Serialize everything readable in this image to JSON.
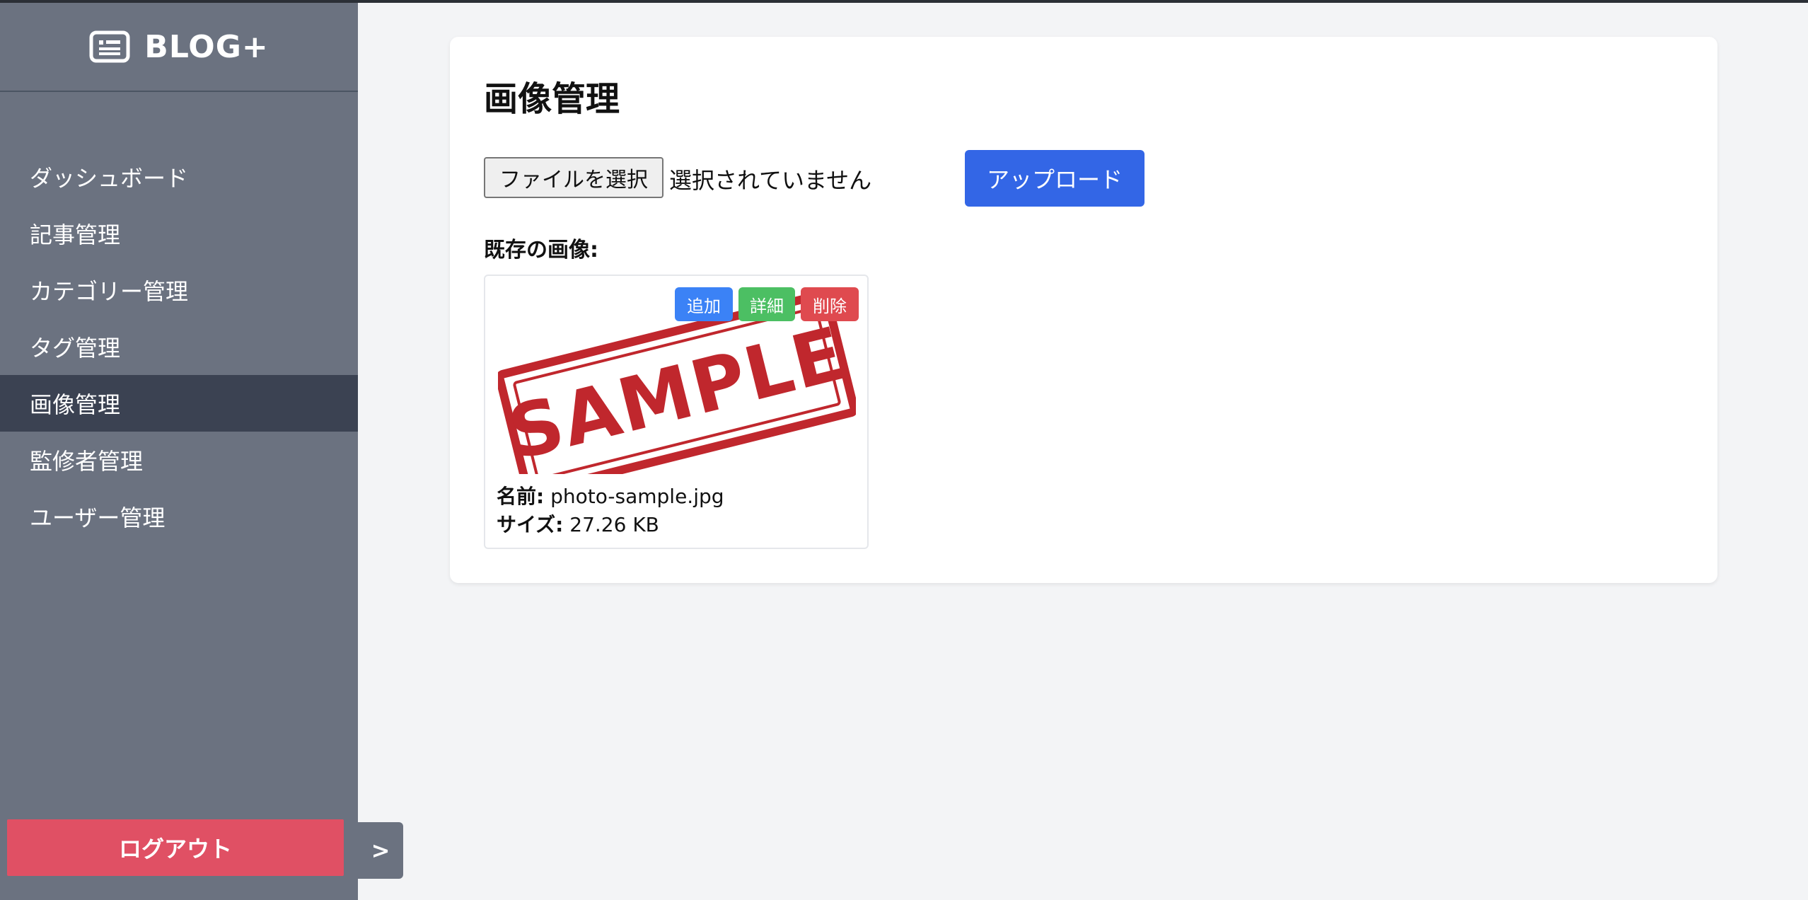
{
  "brand": {
    "name": "BLOG+",
    "icon": "newspaper-icon"
  },
  "sidebar": {
    "items": [
      {
        "label": "ダッシュボード",
        "active": false
      },
      {
        "label": "記事管理",
        "active": false
      },
      {
        "label": "カテゴリー管理",
        "active": false
      },
      {
        "label": "タグ管理",
        "active": false
      },
      {
        "label": "画像管理",
        "active": true
      },
      {
        "label": "監修者管理",
        "active": false
      },
      {
        "label": "ユーザー管理",
        "active": false
      }
    ],
    "logout_label": "ログアウト",
    "toggle_label": ">"
  },
  "main": {
    "title": "画像管理",
    "file_button_label": "ファイルを選択",
    "file_status": "選択されていません",
    "upload_label": "アップロード",
    "existing_label": "既存の画像:",
    "images": [
      {
        "stamp_text": "SAMPLE",
        "name_label": "名前:",
        "name": "photo-sample.jpg",
        "size_label": "サイズ:",
        "size": "27.26 KB",
        "actions": {
          "add": "追加",
          "detail": "詳細",
          "delete": "削除"
        }
      }
    ]
  },
  "colors": {
    "sidebar": "#6b7280",
    "sidebar_active": "#3b4252",
    "logout": "#e05064",
    "upload": "#3366e6",
    "add": "#3b82f6",
    "detail": "#4cbf63",
    "delete": "#df4a4f",
    "stamp_red": "#c0272d"
  }
}
